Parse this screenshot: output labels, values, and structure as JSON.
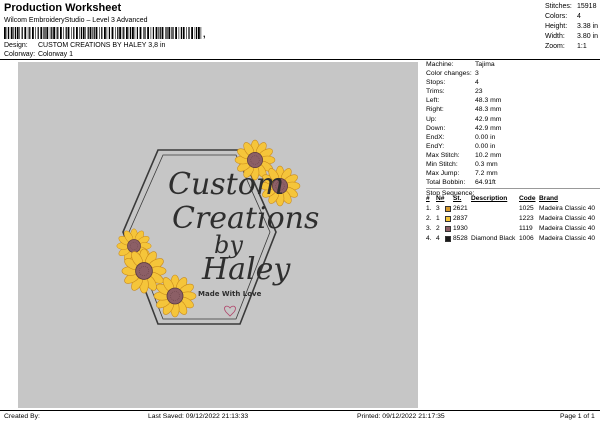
{
  "header": {
    "title": "Production Worksheet",
    "software": "Wilcom EmbroideryStudio – Level 3 Advanced",
    "barcode_suffix": ",",
    "design_label": "Design:",
    "design_value": "CUSTOM CREATIONS BY HALEY 3,8 in",
    "colorway_label": "Colorway:",
    "colorway_value": "Colorway 1"
  },
  "stats": [
    {
      "label": "Stitches:",
      "value": "15918"
    },
    {
      "label": "Colors:",
      "value": "4"
    },
    {
      "label": "Height:",
      "value": "3.38 in"
    },
    {
      "label": "Width:",
      "value": "3.80 in"
    },
    {
      "label": "Zoom:",
      "value": "1:1"
    }
  ],
  "design_text": {
    "line1": "Custom",
    "line2": "Creations",
    "line3": "by",
    "line4": "Haley",
    "tagline": "Made With Love"
  },
  "properties": [
    {
      "label": "Machine:",
      "value": "Tajima"
    },
    {
      "label": "Color changes:",
      "value": "3"
    },
    {
      "label": "Stops:",
      "value": "4"
    },
    {
      "label": "Trims:",
      "value": "23"
    },
    {
      "label": "Left:",
      "value": "48.3 mm"
    },
    {
      "label": "Right:",
      "value": "48.3 mm"
    },
    {
      "label": "Up:",
      "value": "42.9 mm"
    },
    {
      "label": "Down:",
      "value": "42.9 mm"
    },
    {
      "label": "EndX:",
      "value": "0.00 in"
    },
    {
      "label": "EndY:",
      "value": "0.00 in"
    },
    {
      "label": "Max Stitch:",
      "value": "10.2 mm"
    },
    {
      "label": "Min Stitch:",
      "value": "0.3 mm"
    },
    {
      "label": "Max Jump:",
      "value": "7.2 mm"
    },
    {
      "label": "Total Bobbin:",
      "value": "64.91ft"
    }
  ],
  "stop_sequence": {
    "title": "Stop Sequence:",
    "headers": {
      "stop": "#",
      "n": "N#",
      "st": "St.",
      "desc": "Description",
      "code": "Code",
      "brand": "Brand"
    },
    "rows": [
      {
        "stop": "1.",
        "n": "3",
        "color": "#d79a2e",
        "st": "2621",
        "desc": "",
        "code": "1025",
        "brand": "Madeira Classic 40"
      },
      {
        "stop": "2.",
        "n": "1",
        "color": "#f5c53a",
        "st": "2837",
        "desc": "",
        "code": "1223",
        "brand": "Madeira Classic 40"
      },
      {
        "stop": "3.",
        "n": "2",
        "color": "#8c5f66",
        "st": "1930",
        "desc": "",
        "code": "1119",
        "brand": "Madeira Classic 40"
      },
      {
        "stop": "4.",
        "n": "4",
        "color": "#1a1a1a",
        "st": "8528",
        "desc": "Diamond Black",
        "code": "1006",
        "brand": "Madeira Classic 40"
      }
    ]
  },
  "footer": {
    "created_by": "Created By:",
    "last_saved": "Last Saved: 09/12/2022 21:13:33",
    "printed": "Printed: 09/12/2022 21:17:35",
    "page": "Page 1 of 1"
  },
  "colors": {
    "canvas_bg": "#c6c6c6",
    "frame": "#3a3a3a",
    "petal": "#f5c53a",
    "petal_dark": "#d79a2e",
    "center": "#8c5f66",
    "text": "#2e2e2e"
  }
}
